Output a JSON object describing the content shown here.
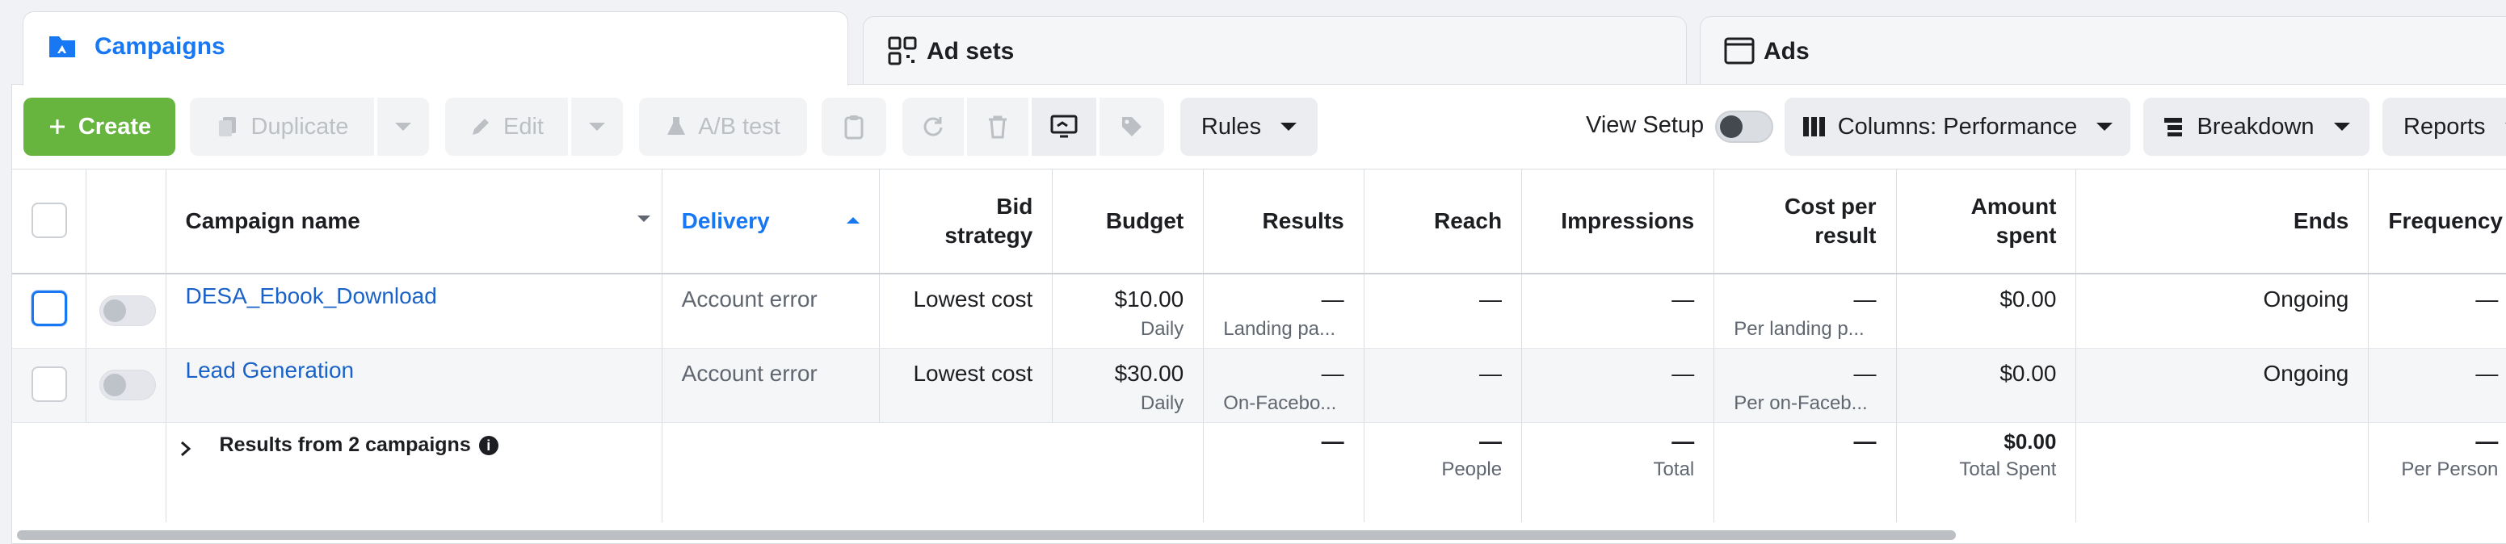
{
  "tabs": {
    "campaigns": "Campaigns",
    "ad_sets": "Ad sets",
    "ads": "Ads"
  },
  "toolbar": {
    "create": "Create",
    "duplicate": "Duplicate",
    "edit": "Edit",
    "ab_test": "A/B test",
    "rules": "Rules",
    "view_setup": "View Setup",
    "columns": "Columns: Performance",
    "breakdown": "Breakdown",
    "reports": "Reports"
  },
  "table": {
    "headers": {
      "campaign_name": "Campaign name",
      "delivery": "Delivery",
      "bid_strategy": "Bid strategy",
      "budget": "Budget",
      "results": "Results",
      "reach": "Reach",
      "impressions": "Impressions",
      "cost_per_result": "Cost per result",
      "amount_spent": "Amount spent",
      "ends": "Ends",
      "frequency": "Frequency"
    },
    "rows": [
      {
        "name": "DESA_Ebook_Download",
        "delivery": "Account error",
        "bid_strategy": "Lowest cost",
        "budget": "$10.00",
        "budget_type": "Daily",
        "results": "—",
        "results_sub": "Landing pa...",
        "reach": "—",
        "impressions": "—",
        "cost_per_result": "—",
        "cost_sub": "Per landing p...",
        "amount_spent": "$0.00",
        "ends": "Ongoing",
        "frequency": "—"
      },
      {
        "name": "Lead Generation",
        "delivery": "Account error",
        "bid_strategy": "Lowest cost",
        "budget": "$30.00",
        "budget_type": "Daily",
        "results": "—",
        "results_sub": "On-Facebo...",
        "reach": "—",
        "impressions": "—",
        "cost_per_result": "—",
        "cost_sub": "Per on-Faceb...",
        "amount_spent": "$0.00",
        "ends": "Ongoing",
        "frequency": "—"
      }
    ],
    "totals": {
      "label": "Results from 2 campaigns",
      "results": "—",
      "reach": "—",
      "reach_sub": "People",
      "impressions": "—",
      "impressions_sub": "Total",
      "cost_per_result": "—",
      "amount_spent": "$0.00",
      "amount_sub": "Total Spent",
      "frequency": "—",
      "frequency_sub": "Per Person"
    }
  },
  "colors": {
    "accent": "#1877f2",
    "create_green": "#67b53f",
    "link": "#1a62c7"
  }
}
